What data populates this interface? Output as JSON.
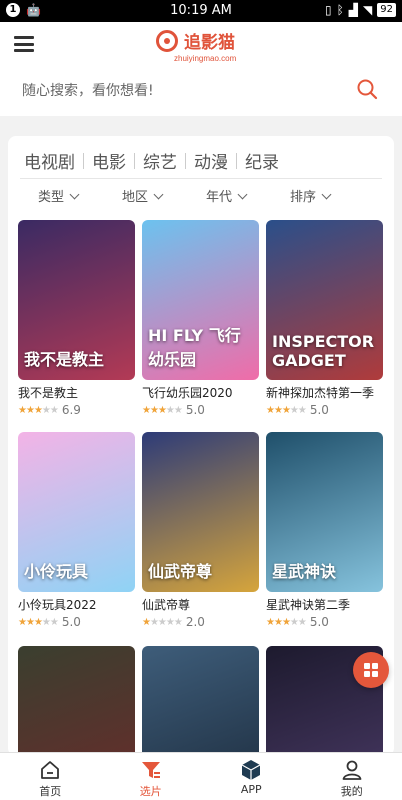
{
  "status": {
    "notif_count": "1",
    "time": "10:19 AM",
    "battery": "92"
  },
  "header": {
    "logo_name": "追影猫",
    "logo_url": "zhuiyingmao.com"
  },
  "search": {
    "placeholder": "随心搜索，看你想看!"
  },
  "categories": [
    "电视剧",
    "电影",
    "综艺",
    "动漫",
    "纪录"
  ],
  "filters": [
    "类型",
    "地区",
    "年代",
    "排序"
  ],
  "items": [
    {
      "title": "我不是教主",
      "rating": "6.9",
      "stars": 3,
      "poster_text": "我不是教主",
      "colors": [
        "#3a2a63",
        "#b33a55"
      ]
    },
    {
      "title": "飞行幼乐园2020",
      "rating": "5.0",
      "stars": 2.5,
      "poster_text": "HI FLY 飞行幼乐园",
      "colors": [
        "#6cc2ef",
        "#f06ca8"
      ]
    },
    {
      "title": "新神探加杰特第一季",
      "rating": "5.0",
      "stars": 2.5,
      "poster_text": "INSPECTOR GADGET",
      "colors": [
        "#2a4f8a",
        "#b03b3b"
      ]
    },
    {
      "title": "小伶玩具2022",
      "rating": "5.0",
      "stars": 2.5,
      "poster_text": "小伶玩具",
      "colors": [
        "#f3b3e6",
        "#8fd3f5"
      ]
    },
    {
      "title": "仙武帝尊",
      "rating": "2.0",
      "stars": 1,
      "poster_text": "仙武帝尊",
      "colors": [
        "#2d3b78",
        "#d6a53c"
      ]
    },
    {
      "title": "星武神诀第二季",
      "rating": "5.0",
      "stars": 2.5,
      "poster_text": "星武神诀",
      "colors": [
        "#1f4f6a",
        "#86c3dd"
      ]
    },
    {
      "title": "",
      "rating": "",
      "stars": 0,
      "poster_text": "",
      "colors": [
        "#3a3f2f",
        "#6b2b2b"
      ]
    },
    {
      "title": "",
      "rating": "",
      "stars": 0,
      "poster_text": "",
      "colors": [
        "#3e5d7a",
        "#1c2b3c"
      ]
    },
    {
      "title": "",
      "rating": "",
      "stars": 0,
      "poster_text": "",
      "colors": [
        "#1d1a2e",
        "#4a3a66"
      ]
    }
  ],
  "tabs": [
    {
      "label": "首页",
      "icon": "home-icon"
    },
    {
      "label": "选片",
      "icon": "filter-icon"
    },
    {
      "label": "APP",
      "icon": "app-box-icon"
    },
    {
      "label": "我的",
      "icon": "user-icon"
    }
  ],
  "accent": "#e4573b"
}
